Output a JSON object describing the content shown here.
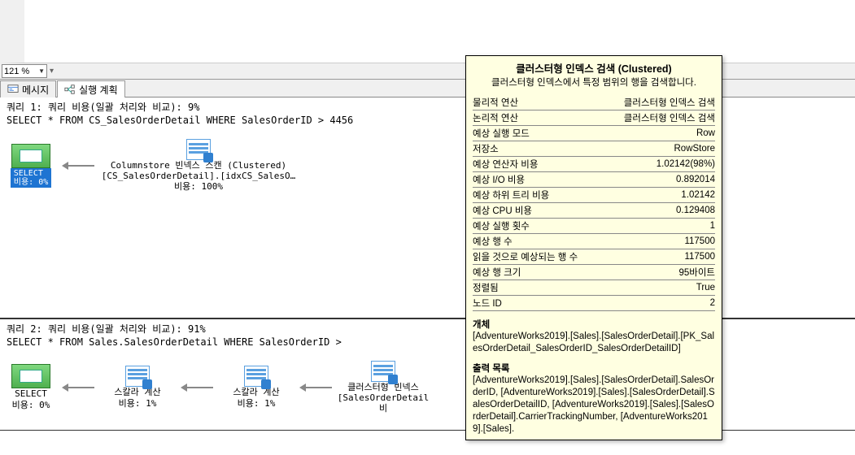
{
  "zoom": "121 %",
  "tabs": {
    "messages": "메시지",
    "plan": "실행 계획"
  },
  "q1": {
    "header": "쿼리 1: 쿼리 비용(일괄 처리와 비교): 9%",
    "sql": "SELECT * FROM CS_SalesOrderDetail WHERE SalesOrderID > 4456",
    "select": {
      "label": "SELECT",
      "cost": "비용: 0%"
    },
    "op": {
      "l1": "Columnstore 빈넥스 스캔 (Clustered)",
      "l2": "[CS_SalesOrderDetail].[idxCS_SalesO…",
      "l3": "비용: 100%"
    }
  },
  "q2": {
    "header": "쿼리 2: 쿼리 비용(일괄 처리와 비교): 91%",
    "sql": "SELECT * FROM Sales.SalesOrderDetail WHERE SalesOrderID >",
    "select": {
      "label": "SELECT",
      "cost": "비용: 0%"
    },
    "scalar1": {
      "l1": "스칼라 계산",
      "l2": "비용: 1%"
    },
    "scalar2": {
      "l1": "스칼라 계산",
      "l2": "비용: 1%"
    },
    "op": {
      "l1": "클러스터형 빈넥스",
      "l2": "[SalesOrderDetail",
      "l3": "비"
    }
  },
  "tooltip": {
    "title": "클러스터형 인덱스 검색 (Clustered)",
    "sub": "클러스터형 인덱스에서 특정 범위의 행을 검색합니다.",
    "rows": [
      {
        "k": "물리적 연산",
        "v": "클러스터형 인덱스 검색"
      },
      {
        "k": "논리적 연산",
        "v": "클러스터형 인덱스 검색"
      },
      {
        "k": "예상 실행 모드",
        "v": "Row"
      },
      {
        "k": "저장소",
        "v": "RowStore"
      },
      {
        "k": "예상 연산자 비용",
        "v": "1.02142(98%)"
      },
      {
        "k": "예상 I/O 비용",
        "v": "0.892014"
      },
      {
        "k": "예상 하위 트리 비용",
        "v": "1.02142"
      },
      {
        "k": "예상 CPU 비용",
        "v": "0.129408"
      },
      {
        "k": "예상 실행 횟수",
        "v": "1"
      },
      {
        "k": "예상 행 수",
        "v": "117500"
      },
      {
        "k": "읽을 것으로 예상되는 행 수",
        "v": "117500"
      },
      {
        "k": "예상 행 크기",
        "v": "95바이트"
      },
      {
        "k": "정렬됨",
        "v": "True"
      },
      {
        "k": "노드 ID",
        "v": "2"
      }
    ],
    "obj_h": "개체",
    "obj_body": "[AdventureWorks2019].[Sales].[SalesOrderDetail].[PK_SalesOrderDetail_SalesOrderID_SalesOrderDetailID]",
    "out_h": "출력 목록",
    "out_body": "[AdventureWorks2019].[Sales].[SalesOrderDetail].SalesOrderID, [AdventureWorks2019].[Sales].[SalesOrderDetail].SalesOrderDetailID, [AdventureWorks2019].[Sales].[SalesOrderDetail].CarrierTrackingNumber, [AdventureWorks2019].[Sales]."
  }
}
